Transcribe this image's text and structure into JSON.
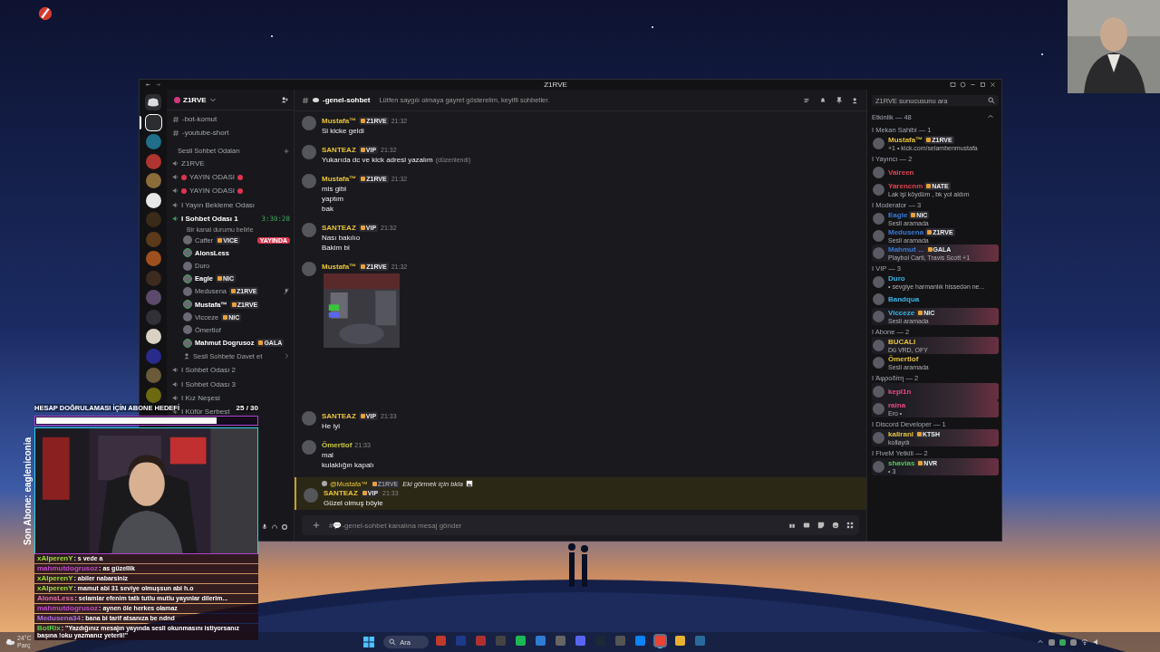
{
  "window": {
    "title": "Z1RVE"
  },
  "servers": [
    {
      "color": "#2b2d31",
      "selected": true
    },
    {
      "color": "#1f6f8b",
      "selected": false
    },
    {
      "color": "#b0342f",
      "selected": false
    },
    {
      "color": "#8a6d3b",
      "selected": false
    },
    {
      "color": "#e8e8e8",
      "selected": false
    },
    {
      "color": "#3a2a1a",
      "selected": false
    },
    {
      "color": "#5a3a1a",
      "selected": false
    },
    {
      "color": "#a0501e",
      "selected": false
    },
    {
      "color": "#3d2b1f",
      "selected": false
    },
    {
      "color": "#5b4a6b",
      "selected": false
    },
    {
      "color": "#303036",
      "selected": false
    },
    {
      "color": "#d8d2c4",
      "selected": false
    },
    {
      "color": "#2a2a8a",
      "selected": false
    },
    {
      "color": "#6b5a3a",
      "selected": false
    },
    {
      "color": "#6b6a10",
      "selected": false
    }
  ],
  "channel_sidebar": {
    "server_name": "Z1RVE",
    "channels": [
      {
        "kind": "text",
        "name": "-bot-komut"
      },
      {
        "kind": "text",
        "name": "-youtube-short"
      },
      {
        "kind": "category",
        "name": "Sesli Sohbet Odaları"
      },
      {
        "kind": "voice",
        "name": "Z1RVE",
        "red_dots": false,
        "active": false
      },
      {
        "kind": "voice",
        "name": "YAYIN ODASI",
        "red_dots": true,
        "active": false
      },
      {
        "kind": "voice",
        "name": "YAYIN ODASI",
        "red_dots": true,
        "active": false
      },
      {
        "kind": "voice",
        "name": "I Yayın Bekleme Odası",
        "red_dots": false,
        "active": false
      },
      {
        "kind": "voice",
        "name": "I Sohbet Odası 1",
        "red_dots": false,
        "active": true,
        "timer": "3:30:28",
        "status": "Bir kanal durumu belirle",
        "invite": "Sesli Sohbete Davet et",
        "members": [
          {
            "name": "Caffer",
            "tag": "VICE",
            "speaking": false,
            "muted": false,
            "badge": "YAYINDA"
          },
          {
            "name": "AlonsLess",
            "speaking": true,
            "muted": false
          },
          {
            "name": "Duro",
            "speaking": false,
            "muted": false
          },
          {
            "name": "Eagle",
            "tag": "NIC",
            "speaking": true,
            "muted": false
          },
          {
            "name": "Medusena",
            "tag": "Z1RVE",
            "speaking": false,
            "muted": true
          },
          {
            "name": "Mustafa™",
            "tag": "Z1RVE",
            "speaking": true,
            "muted": false
          },
          {
            "name": "Vicceze",
            "tag": "NIC",
            "speaking": false,
            "muted": false
          },
          {
            "name": "Ömertlof",
            "speaking": false,
            "muted": false
          },
          {
            "name": "Mahmut Dogrusoz",
            "tag": "GALA",
            "speaking": true,
            "muted": false
          }
        ]
      },
      {
        "kind": "voice",
        "name": "I Sohbet Odası 2",
        "red_dots": false,
        "active": false
      },
      {
        "kind": "voice",
        "name": "I Sohbet Odası 3",
        "red_dots": false,
        "active": false
      },
      {
        "kind": "voice",
        "name": "I Kız Neşesi",
        "red_dots": false,
        "active": false
      },
      {
        "kind": "voice",
        "name": "I Küfür Serbest",
        "red_dots": false,
        "active": false
      }
    ]
  },
  "chat": {
    "channel": "-genel-sohbet",
    "topic": "Lütfen saygılı olmaya gayret gösterelim, keyifli sohbetler.",
    "placeholder": "#💬-genel-sohbet kanalına mesaj gönder",
    "messages": [
      {
        "author": "Mustafa™",
        "color": "#e8c33a",
        "tag": "Z1RVE",
        "time": "21:32",
        "lines": [
          "Si kicke geldi"
        ],
        "highlighted": false
      },
      {
        "author": "SANTEAZ",
        "color": "#e8c33a",
        "tag": "VIP",
        "time": "21:32",
        "lines": [
          "Yukarıda dc ve kick adresi yazalım"
        ],
        "edited": "(düzenlendi)",
        "highlighted": false
      },
      {
        "author": "Mustafa™",
        "color": "#e8c33a",
        "tag": "Z1RVE",
        "time": "21:32",
        "lines": [
          "mis gibi",
          "yaptım",
          "bak"
        ],
        "highlighted": false
      },
      {
        "author": "SANTEAZ",
        "color": "#e8c33a",
        "tag": "VIP",
        "time": "21:32",
        "lines": [
          "Nası bakılıo",
          "Bakim bi"
        ],
        "highlighted": false
      },
      {
        "author": "Mustafa™",
        "color": "#e8c33a",
        "tag": "Z1RVE",
        "time": "21:32",
        "highlighted": false
      },
      {
        "author": "SANTEAZ",
        "color": "#e8c33a",
        "tag": "VIP",
        "time": "21:33",
        "lines": [
          "He iyi"
        ],
        "highlighted": false
      },
      {
        "author": "Ömertlof",
        "color": "#c9cc3c",
        "time": "21:33",
        "lines": [
          "mal",
          "kulaklığın kapalı"
        ],
        "highlighted": false
      },
      {
        "author": "SANTEAZ",
        "color": "#e8c33a",
        "tag": "VIP",
        "time": "21:33",
        "lines": [
          "Güzel olmuş böyle"
        ],
        "highlighted": true,
        "reply": {
          "author": "@Mustafa™",
          "tag": "Z1RVE",
          "text": "Eki görmek için tıkla"
        }
      }
    ]
  },
  "members": {
    "search_placeholder": "Z1RVE sunucusunu ara",
    "activity_header": "Etkinlik — 48",
    "groups": [
      {
        "title": "I Mekan Sahibi — 1",
        "members": [
          {
            "name": "Mustafa™",
            "color": "#e8c33a",
            "tag": "Z1RVE",
            "activity": "+1 • kick.com/selambenmustafa",
            "banner": false
          }
        ]
      },
      {
        "title": "I Yayıncı — 2",
        "members": [
          {
            "name": "Vaireen",
            "color": "#e0434f",
            "banner": false
          },
          {
            "name": "Yarencnm",
            "color": "#e0434f",
            "tag": "NATE",
            "activity": "Lak işi köydüm , bk yol aldım",
            "banner": false
          }
        ]
      },
      {
        "title": "I Moderator — 3",
        "members": [
          {
            "name": "Eagle",
            "color": "#3a7bd5",
            "tag": "NIC",
            "activity": "Sesli aramada",
            "banner": false
          },
          {
            "name": "Medusena",
            "color": "#3a7bd5",
            "tag": "Z1RVE",
            "activity": "Sesli aramada",
            "banner": false
          },
          {
            "name": "Mahmut ...",
            "color": "#3a7bd5",
            "tag": "GALA",
            "activity": "Playboi Carti, Travis Scott +1",
            "banner": true
          }
        ]
      },
      {
        "title": "I VIP — 3",
        "members": [
          {
            "name": "Duro",
            "color": "#38b6e8",
            "activity": "• sevgiye harmanlık hissedən ne...",
            "banner": false
          },
          {
            "name": "Bandqua",
            "color": "#38b6e8",
            "banner": false
          },
          {
            "name": "Vicceze",
            "color": "#38b6e8",
            "tag": "NIC",
            "activity": "Sesli aramada",
            "banner": true
          }
        ]
      },
      {
        "title": "I Abone — 2",
        "members": [
          {
            "name": "BUCALI",
            "color": "#e8c33a",
            "activity": "Dü VRD, OFY",
            "banner": true
          },
          {
            "name": "Ömertlof",
            "color": "#e8c33a",
            "activity": "Sesli aramada",
            "banner": false
          }
        ]
      },
      {
        "title": "I Άφροδίτη — 2",
        "members": [
          {
            "name": "kepl1n",
            "color": "#e84a8a",
            "banner": true
          },
          {
            "name": "raina",
            "color": "#e84a8a",
            "activity": "Ero •",
            "banner": true
          }
        ]
      },
      {
        "title": "I Discord Developer — 1",
        "members": [
          {
            "name": "kaliranl",
            "color": "#e8c33a",
            "tag": "KTSH",
            "activity": "kollaydı",
            "banner": true
          }
        ]
      },
      {
        "title": "I FiveM Yetkili — 2",
        "members": [
          {
            "name": "shavias",
            "color": "#57c45a",
            "tag": "NVR",
            "activity": "• 3",
            "banner": true
          }
        ]
      }
    ]
  },
  "overlay": {
    "goal": {
      "title": "HESAP DOĞRULAMASI İÇİN ABONE HEDEFİ",
      "count": "25 / 30",
      "level": 0.82
    },
    "last_sub": "Son Abone: eagleniconia",
    "chat": [
      {
        "user": "xAlperenY",
        "color": "#9be03a",
        "text": ": s vede a"
      },
      {
        "user": "mahmutdogrusoz",
        "color": "#c04ad0",
        "text": ": as güzellik"
      },
      {
        "user": "xAlperenY",
        "color": "#9be03a",
        "text": ": abiler nabarsiniz"
      },
      {
        "user": "xAlperenY",
        "color": "#9be03a",
        "text": ": mamut abi 31 seviye olmuşsun abi h.o"
      },
      {
        "user": "AlonsLess",
        "color": "#e070b0",
        "text": ": selamlar efenim tatlı tutlu mutlu yayınlar dilerim..."
      },
      {
        "user": "mahmutdogrusoz",
        "color": "#c04ad0",
        "text": ": aynen öle herkes olamaz"
      },
      {
        "user": "Medusena34",
        "color": "#b070e8",
        "text": ": bana bi tarif atsanıza be ndnd"
      },
      {
        "user": "BotRix",
        "color": "#5ad04a",
        "text": ": \"Yazdığınız mesajın yayında sesli okunmasını istiyorsanız başına !oku yazmanız yeterli!\""
      }
    ]
  },
  "taskbar": {
    "weather": {
      "temp": "24°C",
      "text": "Parç"
    },
    "search": "Ara",
    "apps": [
      {
        "color": "#c0392b",
        "selected": false
      },
      {
        "color": "#1e3a8a",
        "selected": false
      },
      {
        "color": "#b03030",
        "selected": false
      },
      {
        "color": "#444",
        "selected": false
      },
      {
        "color": "#1db954",
        "selected": false
      },
      {
        "color": "#2d7dd2",
        "selected": false
      },
      {
        "color": "#666",
        "selected": false
      },
      {
        "color": "#5865f2",
        "selected": false
      },
      {
        "color": "#1b2838",
        "selected": false
      },
      {
        "color": "#555",
        "selected": false
      },
      {
        "color": "#0a84ff",
        "selected": false
      },
      {
        "color": "#ea4335",
        "selected": true
      },
      {
        "color": "#e8b130",
        "selected": false
      },
      {
        "color": "#2a6a9a",
        "selected": false
      }
    ]
  }
}
